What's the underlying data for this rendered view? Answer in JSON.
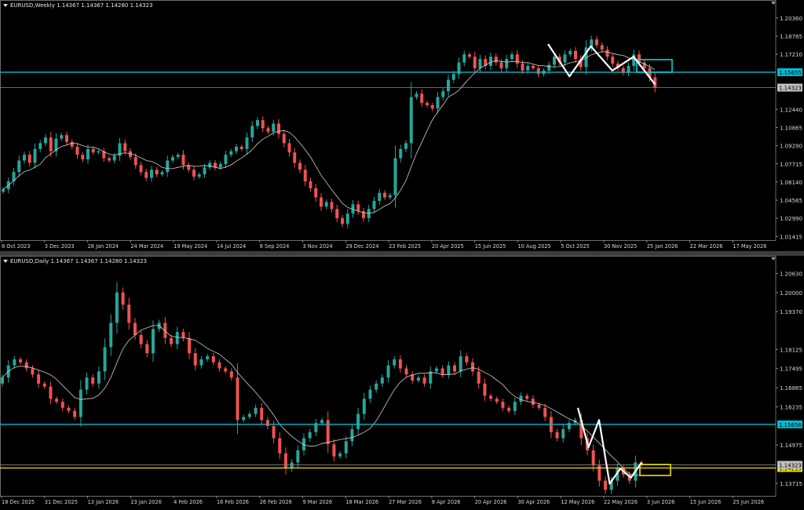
{
  "panes": [
    {
      "id": "weekly",
      "title": "EURUSD,Weekly  1.14367 1.14367 1.14280 1.14323",
      "price_min": 1.011,
      "price_max": 1.211,
      "y_ticks": [
        "1.20360",
        "1.18785",
        "1.17210",
        "1.15655",
        "1.14323",
        "1.12440",
        "1.10865",
        "1.09290",
        "1.07715",
        "1.06140",
        "1.04565",
        "1.02990",
        "1.01415"
      ],
      "x_ticks": [
        "8 Oct 2023",
        "3 Dec 2023",
        "28 Jan 2024",
        "24 Mar 2024",
        "19 May 2024",
        "14 Jul 2024",
        "8 Sep 2024",
        "3 Nov 2024",
        "29 Dec 2024",
        "23 Feb 2025",
        "20 Apr 2025",
        "15 Jun 2025",
        "10 Aug 2025",
        "5 Oct 2025",
        "30 Nov 2025",
        "25 Jan 2026",
        "22 Mar 2026",
        "17 May 2026"
      ],
      "hlines": [
        {
          "price": 1.15655,
          "color": "#00bcd4",
          "label": "1.15655",
          "label_bg": "#00bcd4"
        },
        {
          "price": 1.14323,
          "color": "#888888",
          "label": "1.14323",
          "label_bg": "#c0c0c0"
        }
      ],
      "box": {
        "color": "#00d4e0"
      },
      "chart_data": {
        "type": "candlestick",
        "symbol": "EURUSD",
        "timeframe": "Weekly",
        "last_bar": {
          "open": 1.14367,
          "high": 1.14367,
          "low": 1.1428,
          "close": 1.14323
        },
        "closes": [
          1.055,
          1.062,
          1.07,
          1.08,
          1.085,
          1.078,
          1.09,
          1.095,
          1.1,
          1.088,
          1.099,
          1.102,
          1.096,
          1.092,
          1.085,
          1.081,
          1.09,
          1.087,
          1.088,
          1.082,
          1.08,
          1.084,
          1.095,
          1.088,
          1.083,
          1.076,
          1.07,
          1.065,
          1.072,
          1.068,
          1.07,
          1.08,
          1.083,
          1.085,
          1.076,
          1.072,
          1.066,
          1.068,
          1.074,
          1.078,
          1.074,
          1.077,
          1.085,
          1.088,
          1.092,
          1.09,
          1.1,
          1.11,
          1.115,
          1.108,
          1.105,
          1.112,
          1.103,
          1.095,
          1.087,
          1.078,
          1.072,
          1.062,
          1.056,
          1.048,
          1.04,
          1.044,
          1.038,
          1.03,
          1.025,
          1.034,
          1.042,
          1.036,
          1.03,
          1.038,
          1.045,
          1.052,
          1.048,
          1.05,
          1.082,
          1.09,
          1.095,
          1.135,
          1.138,
          1.13,
          1.128,
          1.125,
          1.135,
          1.14,
          1.15,
          1.155,
          1.165,
          1.172,
          1.17,
          1.16,
          1.168,
          1.162,
          1.17,
          1.165,
          1.16,
          1.168,
          1.172,
          1.164,
          1.158,
          1.162,
          1.16,
          1.155,
          1.158,
          1.163,
          1.17,
          1.165,
          1.172,
          1.175,
          1.168,
          1.161,
          1.178,
          1.185,
          1.18,
          1.176,
          1.17,
          1.164,
          1.16,
          1.156,
          1.162,
          1.172,
          1.165,
          1.16,
          1.152,
          1.143
        ],
        "ma_period_note": "white moving average line",
        "annotation_zigzag": [
          1.181,
          1.153,
          1.179,
          1.158,
          1.17,
          1.146
        ]
      }
    },
    {
      "id": "daily",
      "title": "EURUSD,Daily  1.14367 1.14367 1.14280 1.14323",
      "price_min": 1.133,
      "price_max": 1.209,
      "y_ticks": [
        "1.20630",
        "1.20000",
        "1.19370",
        "1.18125",
        "1.17495",
        "1.16865",
        "1.16235",
        "1.15656",
        "1.14975",
        "1.14219",
        "1.13715",
        "1.13085"
      ],
      "x_ticks": [
        "18 Dec 2025",
        "31 Dec 2025",
        "13 Jan 2026",
        "23 Jan 2026",
        "4 Feb 2026",
        "16 Feb 2026",
        "26 Feb 2026",
        "9 Mar 2026",
        "18 Mar 2026",
        "27 Mar 2026",
        "8 Apr 2026",
        "20 Apr 2026",
        "30 Apr 2026",
        "12 May 2026",
        "22 May 2026",
        "3 Jun 2026",
        "15 Jun 2026",
        "25 Jun 2026"
      ],
      "hlines": [
        {
          "price": 1.15656,
          "color": "#00bcd4",
          "label": "1.15656",
          "label_bg": "#00bcd4"
        },
        {
          "price": 1.14219,
          "color": "#e6d200",
          "label": "1.14219",
          "label_bg": "#f0e000"
        },
        {
          "price": 1.14323,
          "color": "#888888",
          "label": "1.14323",
          "label_bg": "#c0c0c0"
        }
      ],
      "box": {
        "color": "#f0e000"
      },
      "chart_data": {
        "type": "candlestick",
        "symbol": "EURUSD",
        "timeframe": "Daily",
        "last_bar": {
          "open": 1.14367,
          "high": 1.14367,
          "low": 1.1428,
          "close": 1.14323
        },
        "closes": [
          1.172,
          1.176,
          1.178,
          1.177,
          1.175,
          1.173,
          1.17,
          1.169,
          1.165,
          1.164,
          1.162,
          1.161,
          1.159,
          1.168,
          1.172,
          1.17,
          1.174,
          1.182,
          1.19,
          1.2,
          1.196,
          1.19,
          1.186,
          1.183,
          1.18,
          1.188,
          1.19,
          1.185,
          1.183,
          1.187,
          1.185,
          1.18,
          1.176,
          1.178,
          1.179,
          1.177,
          1.175,
          1.174,
          1.172,
          1.158,
          1.159,
          1.16,
          1.162,
          1.158,
          1.156,
          1.152,
          1.147,
          1.142,
          1.144,
          1.148,
          1.152,
          1.154,
          1.157,
          1.158,
          1.15,
          1.146,
          1.147,
          1.151,
          1.155,
          1.16,
          1.165,
          1.168,
          1.17,
          1.172,
          1.176,
          1.178,
          1.175,
          1.173,
          1.171,
          1.172,
          1.17,
          1.174,
          1.175,
          1.173,
          1.176,
          1.174,
          1.179,
          1.177,
          1.174,
          1.17,
          1.166,
          1.165,
          1.164,
          1.162,
          1.161,
          1.164,
          1.166,
          1.165,
          1.163,
          1.162,
          1.159,
          1.154,
          1.152,
          1.155,
          1.157,
          1.158,
          1.152,
          1.148,
          1.143,
          1.138,
          1.135,
          1.138,
          1.142,
          1.14,
          1.138,
          1.144,
          1.1432
        ],
        "annotation_zigzag": [
          1.162,
          1.149,
          1.158,
          1.137,
          1.142,
          1.139,
          1.144
        ]
      }
    }
  ]
}
